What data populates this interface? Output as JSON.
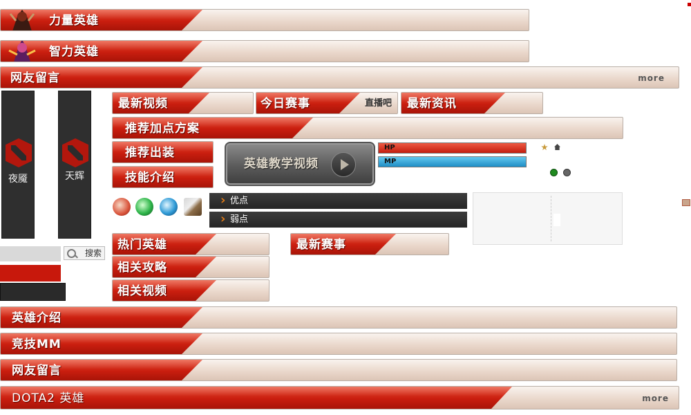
{
  "top_headers": {
    "strength_heroes": "力量英雄",
    "intelligence_heroes": "智力英雄",
    "guestbook": "网友留言",
    "more": "more"
  },
  "factions": {
    "dire": "夜魇",
    "radiant": "天辉"
  },
  "tabs": {
    "latest_video": "最新视频",
    "today_matches": "今日赛事",
    "live_bar": "直播吧",
    "latest_news": "最新资讯",
    "recommended_skill_build": "推荐加点方案",
    "recommended_items": "推荐出装",
    "skill_intro": "技能介绍"
  },
  "tutorial_button": "英雄教学视频",
  "stats": {
    "hp": "HP",
    "mp": "MP"
  },
  "pros_cons": {
    "pros": "优点",
    "cons": "弱点"
  },
  "search": {
    "button": "搜索",
    "placeholder": ""
  },
  "mid_tabs": {
    "hot_heroes": "热门英雄",
    "latest_matches": "最新赛事",
    "related_guides": "相关攻略",
    "related_videos": "相关视频"
  },
  "bottom_headers": {
    "hero_intro": "英雄介绍",
    "competitive_mm": "竞技MM",
    "guestbook": "网友留言",
    "dota2_heroes": "DOTA2 英雄",
    "more": "more"
  },
  "icons": [
    "strength-hero-avatar-icon",
    "intelligence-hero-avatar-icon",
    "dota-logo-icon",
    "search-icon",
    "play-icon",
    "skill-icon"
  ],
  "colors": {
    "banner_red": "#c91e0f",
    "hp_red": "#d0281a",
    "mp_blue": "#2a9fd0",
    "dark_panel": "#2f2f2f"
  }
}
